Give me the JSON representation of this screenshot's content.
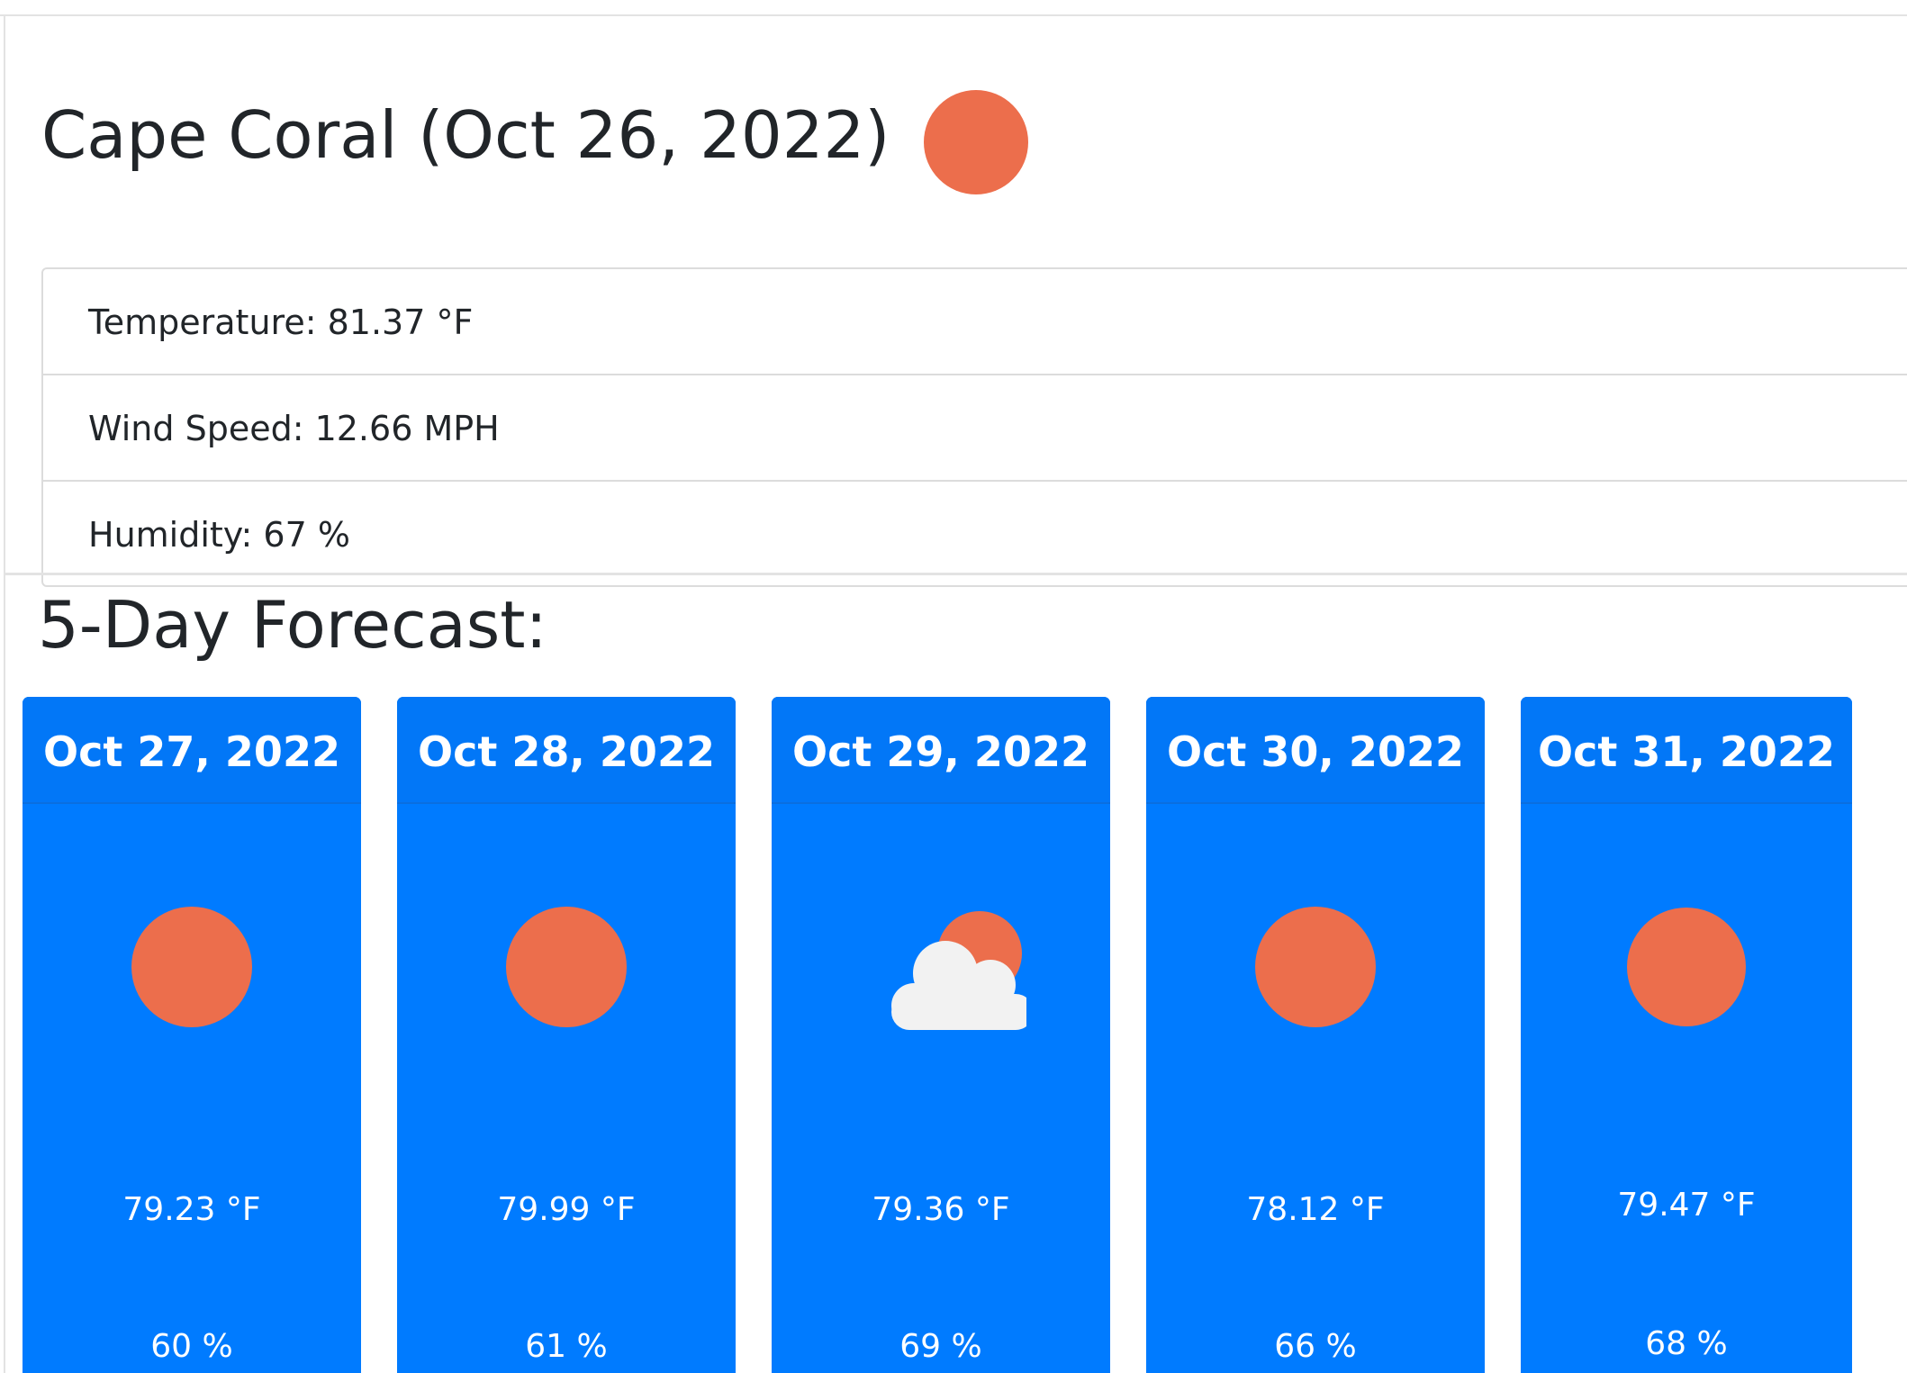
{
  "current": {
    "title": "Cape Coral (Oct 26, 2022)",
    "icon": "sun-icon",
    "temperature": "Temperature: 81.37 °F",
    "wind_speed": "Wind Speed: 12.66 MPH",
    "humidity": "Humidity: 67 %"
  },
  "forecast": {
    "title": "5-Day Forecast:",
    "days": [
      {
        "date": "Oct 27, 2022",
        "icon": "sun-icon",
        "temp": "79.23 °F",
        "humidity": "60 %"
      },
      {
        "date": "Oct 28, 2022",
        "icon": "sun-icon",
        "temp": "79.99 °F",
        "humidity": "61 %"
      },
      {
        "date": "Oct 29, 2022",
        "icon": "partly-cloudy-icon",
        "temp": "79.36 °F",
        "humidity": "69 %"
      },
      {
        "date": "Oct 30, 2022",
        "icon": "sun-icon",
        "temp": "78.12 °F",
        "humidity": "66 %"
      },
      {
        "date": "Oct 31, 2022",
        "icon": "sun-icon",
        "temp": "79.47 °F",
        "humidity": "68 %"
      }
    ]
  },
  "colors": {
    "card_blue": "#007bff",
    "sun": "#ec6e4c",
    "cloud": "#f2f2f2"
  }
}
